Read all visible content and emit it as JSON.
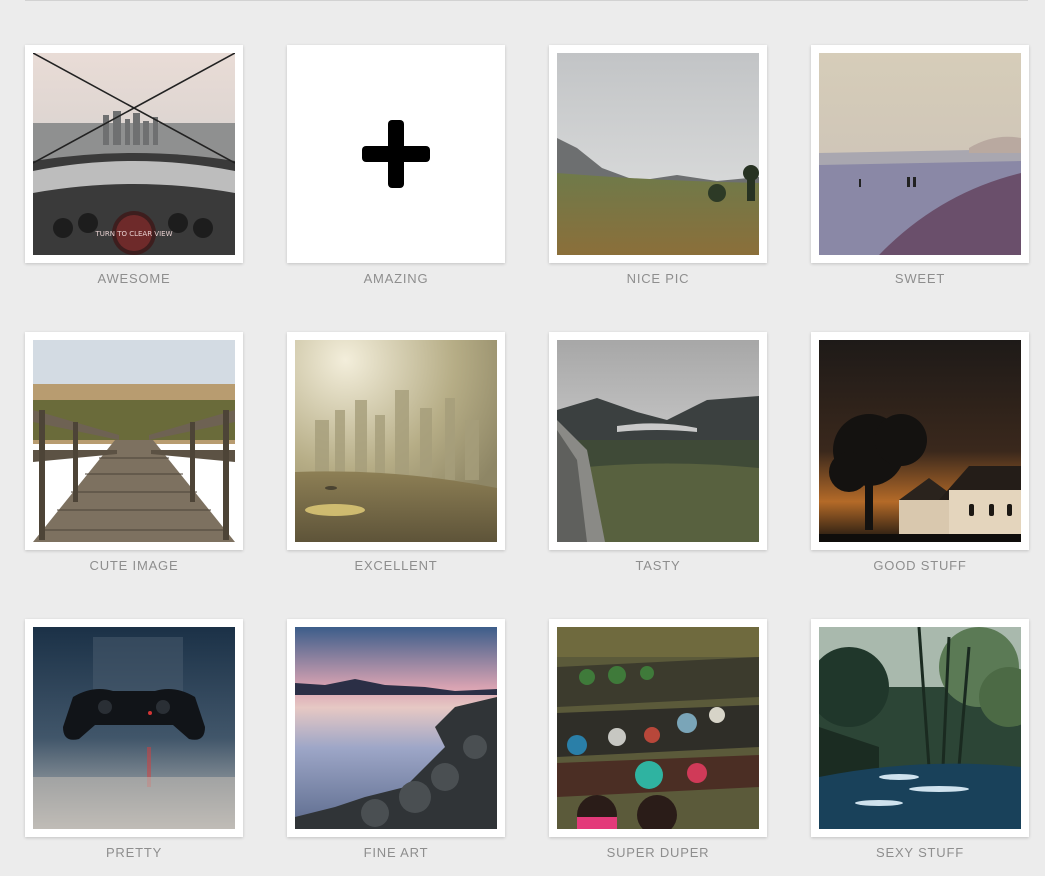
{
  "gallery": {
    "items": [
      {
        "caption": "AWESOME",
        "image": "city-skyline-from-helicopter-window-photo"
      },
      {
        "caption": "AMAZING",
        "image": "add-new-plus-icon"
      },
      {
        "caption": "NICE PIC",
        "image": "mountain-valley-meadow-photo"
      },
      {
        "caption": "SWEET",
        "image": "misty-beach-shoreline-photo"
      },
      {
        "caption": "CUTE IMAGE",
        "image": "wooden-boardwalk-bridge-photo"
      },
      {
        "caption": "EXCELLENT",
        "image": "hazy-golden-city-lake-photo"
      },
      {
        "caption": "TASTY",
        "image": "green-highland-valley-photo"
      },
      {
        "caption": "GOOD STUFF",
        "image": "church-at-night-sky-photo"
      },
      {
        "caption": "PRETTY",
        "image": "game-controller-photo"
      },
      {
        "caption": "FINE ART",
        "image": "rocky-lake-sunset-photo"
      },
      {
        "caption": "SUPER DUPER",
        "image": "floating-market-boats-photo"
      },
      {
        "caption": "SEXY STUFF",
        "image": "forest-stream-photo"
      }
    ]
  },
  "overlays": {
    "sign_text": "TURN TO CLEAR VIEW"
  }
}
